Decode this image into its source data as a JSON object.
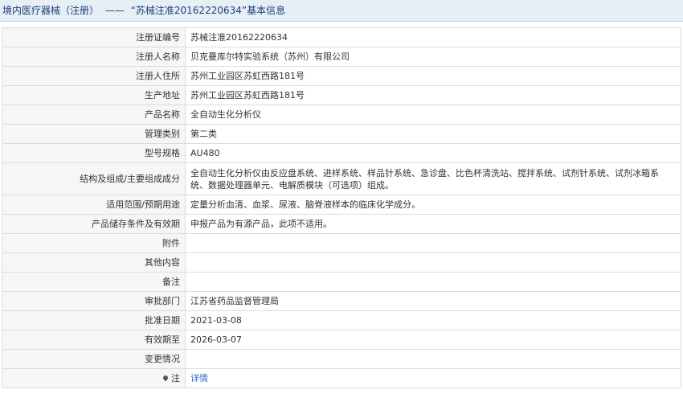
{
  "header": {
    "section": "境内医疗器械（注册）",
    "separator": "——",
    "title": "“苏械注准20162220634”基本信息"
  },
  "rows": [
    {
      "label": "注册证编号",
      "value": "苏械注准20162220634"
    },
    {
      "label": "注册人名称",
      "value": "贝克曼库尔特实验系统（苏州）有限公司"
    },
    {
      "label": "注册人住所",
      "value": "苏州工业园区苏虹西路181号"
    },
    {
      "label": "生产地址",
      "value": "苏州工业园区苏虹西路181号"
    },
    {
      "label": "产品名称",
      "value": "全自动生化分析仪"
    },
    {
      "label": "管理类别",
      "value": "第二类"
    },
    {
      "label": "型号规格",
      "value": "AU480"
    },
    {
      "label": "结构及组成/主要组成成分",
      "value": "全自动生化分析仪由反应盘系统、进样系统、样品针系统、急诊盘、比色杯清洗站、搅拌系统、试剂针系统、试剂冰箱系统、数据处理器单元、电解质模块（可选项）组成。"
    },
    {
      "label": "适用范围/预期用途",
      "value": "定量分析血清、血浆、尿液、脑脊液样本的临床化学成分。"
    },
    {
      "label": "产品储存条件及有效期",
      "value": "申报产品为有源产品，此项不适用。"
    },
    {
      "label": "附件",
      "value": ""
    },
    {
      "label": "其他内容",
      "value": ""
    },
    {
      "label": "备注",
      "value": ""
    },
    {
      "label": "审批部门",
      "value": "江苏省药品监督管理局"
    },
    {
      "label": "批准日期",
      "value": "2021-03-08"
    },
    {
      "label": "有效期至",
      "value": "2026-03-07"
    },
    {
      "label": "变更情况",
      "value": ""
    }
  ],
  "footer_row": {
    "label": "注",
    "link_text": "详情",
    "icon": "pin-icon"
  }
}
